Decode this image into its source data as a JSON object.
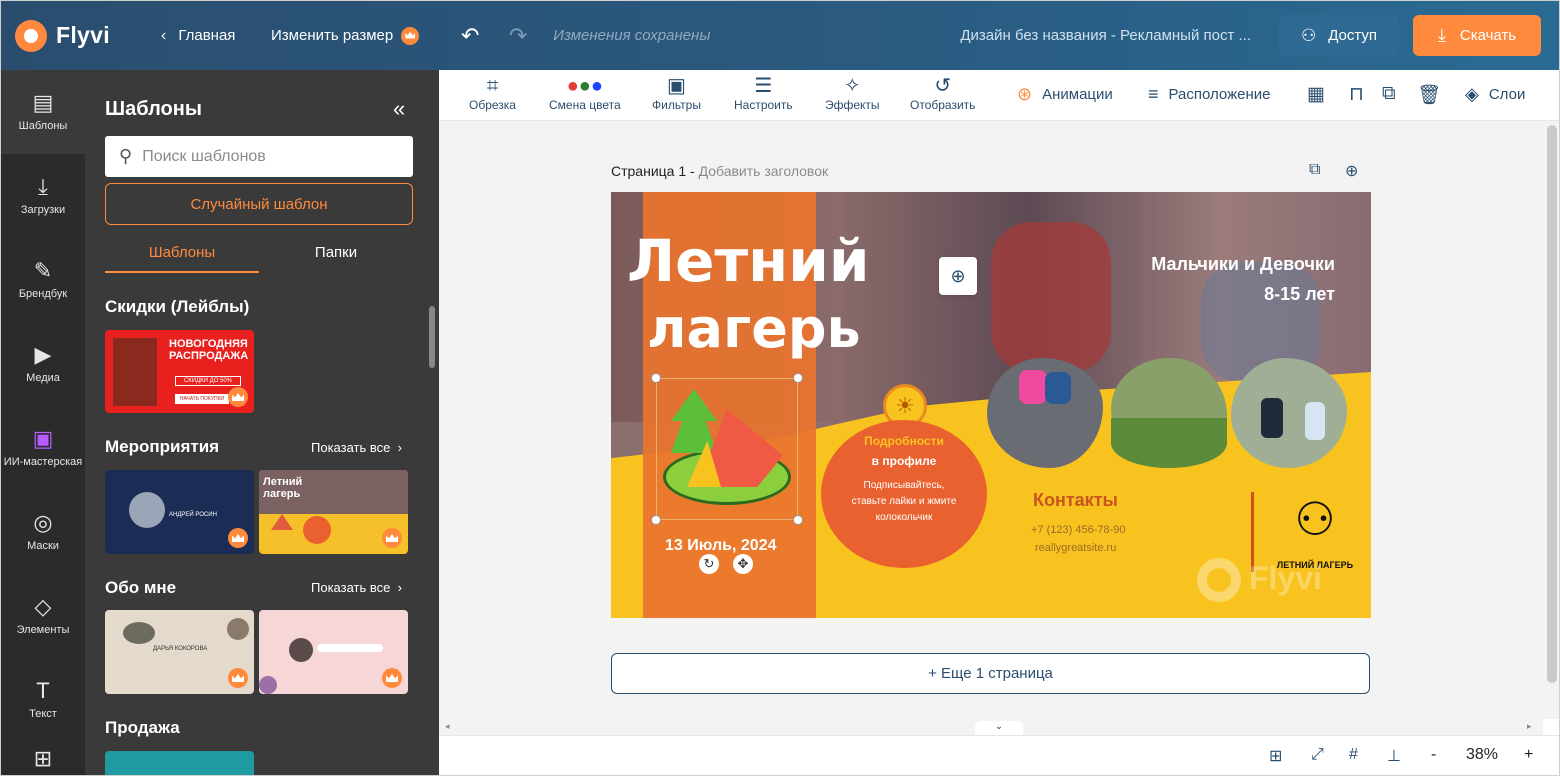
{
  "header": {
    "logo": "Flyvi",
    "back": "Главная",
    "resize": "Изменить размер",
    "saved": "Изменения сохранены",
    "doc_title": "Дизайн без названия - Рекламный пост ...",
    "access": "Доступ",
    "download": "Скачать"
  },
  "rail": [
    {
      "label": "Шаблоны",
      "icon": "layout-icon"
    },
    {
      "label": "Загрузки",
      "icon": "upload-icon"
    },
    {
      "label": "Брендбук",
      "icon": "brandbook-icon"
    },
    {
      "label": "Медиа",
      "icon": "media-icon"
    },
    {
      "label": "ИИ-мастерская",
      "icon": "ai-icon"
    },
    {
      "label": "Маски",
      "icon": "masks-icon"
    },
    {
      "label": "Элементы",
      "icon": "elements-icon"
    },
    {
      "label": "Текст",
      "icon": "text-icon"
    }
  ],
  "panel": {
    "title": "Шаблоны",
    "search_placeholder": "Поиск шаблонов",
    "random": "Случайный шаблон",
    "tabs": [
      "Шаблоны",
      "Папки"
    ],
    "sections": [
      {
        "title": "Скидки (Лейблы)"
      },
      {
        "title": "Мероприятия",
        "show_all": "Показать все"
      },
      {
        "title": "Обо мне",
        "show_all": "Показать все"
      },
      {
        "title": "Продажа"
      }
    ],
    "thumb_texts": {
      "sale_title": "НОВОГОДНЯЯ РАСПРОДАЖА",
      "sale_badge": "СКИДКИ ДО 50%",
      "sale_btn": "НАЧАТЬ ПОКУПКИ",
      "event_name": "АНДРЕЙ РОСИН",
      "camp_title": "Летний лагерь",
      "about_name": "ДАРЬЯ КОКОРОВА"
    }
  },
  "toolbar": {
    "crop": "Обрезка",
    "color": "Смена цвета",
    "filters": "Фильтры",
    "adjust": "Настроить",
    "effects": "Эффекты",
    "flip": "Отобразить",
    "animations": "Анимации",
    "position": "Расположение",
    "layers": "Слои"
  },
  "canvas": {
    "page_label": "Страница 1 - ",
    "page_sub": "Добавить заголовок",
    "add_page": "+ Еще 1 страница",
    "zoom": "38%",
    "zoom_minus": "-",
    "zoom_plus": "+"
  },
  "design": {
    "title_line1": "Летний",
    "title_line2": "лагерь",
    "audience": "Мальчики и Девочки",
    "ages": "8-15 лет",
    "date": "13 Июль, 2024",
    "details_title": "Подробности",
    "details_sub": "в профиле",
    "details_text": "Подписывайтесь, ставьте лайки и жмите колокольчик",
    "contacts_title": "Контакты",
    "phone": "+7 (123) 456-78-90",
    "site": "reallygreatsite.ru",
    "logo_text": "ЛЕТНИЙ ЛАГЕРЬ",
    "watermark": "Flyvi"
  },
  "colors": {
    "brand_orange": "#ff8a3d",
    "header_blue": "#2a4d6e",
    "panel_dark": "#3a3a3a",
    "design_yellow": "#f9c31f",
    "design_orange": "#e9742e"
  }
}
